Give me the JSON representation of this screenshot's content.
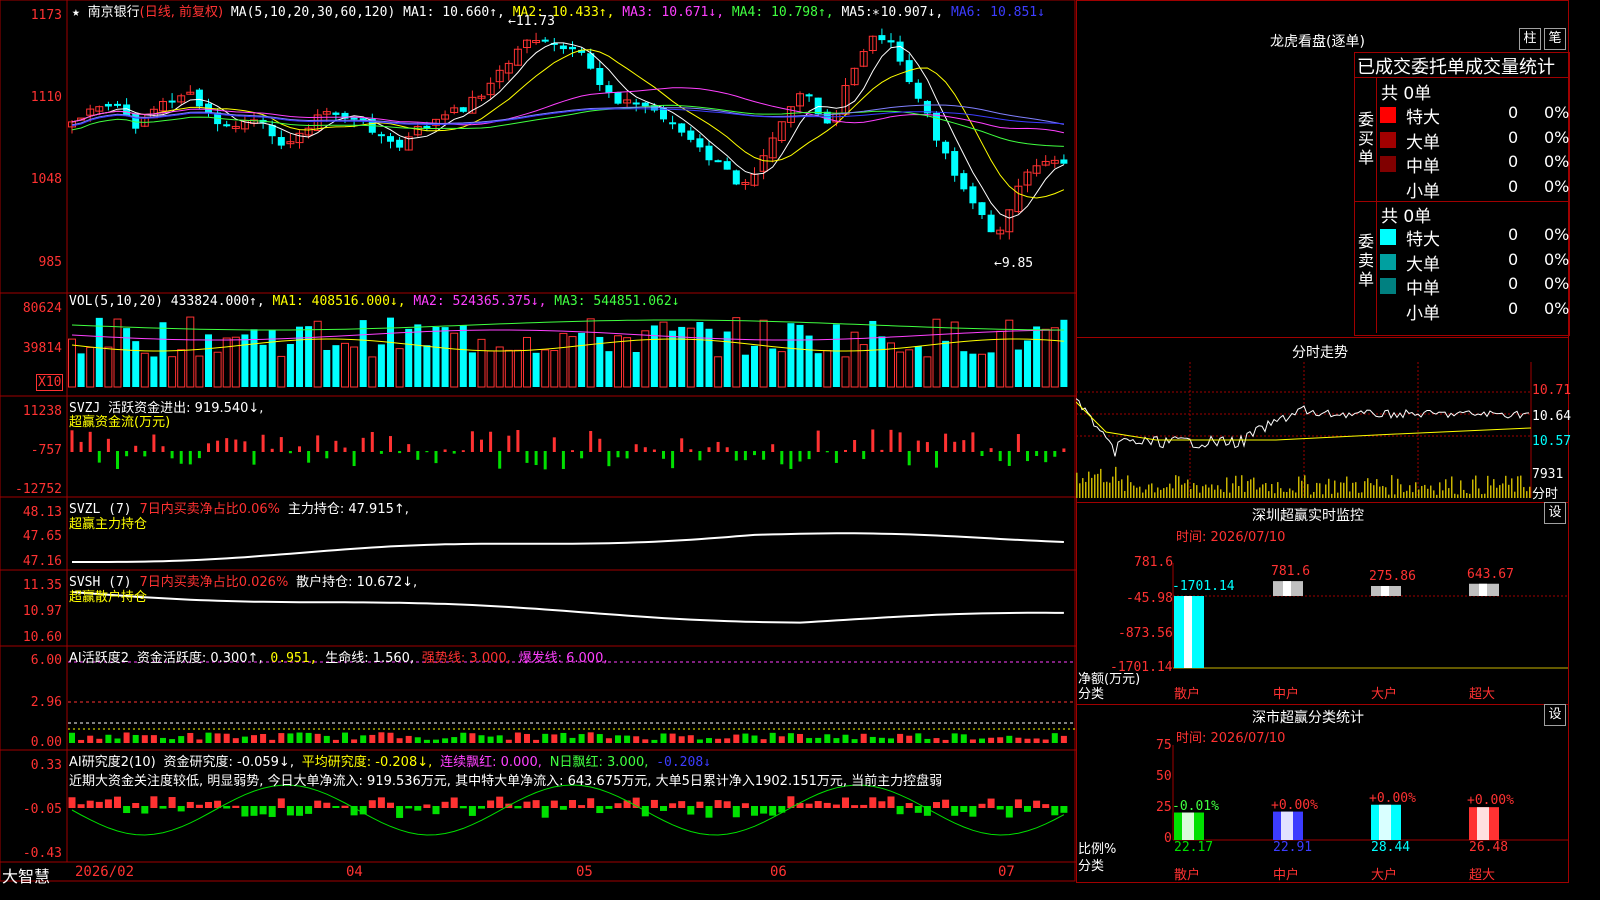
{
  "header": {
    "star": "★",
    "stock_name": "南京银行",
    "period": "(日线, 前复权)",
    "ma_params": "MA(5,10,20,30,60,120)",
    "ma1": "MA1: 10.660↑,",
    "ma2": "MA2: 10.433↑,",
    "ma3": "MA3: 10.671↓,",
    "ma4": "MA4: 10.798↑,",
    "ma5": "MA5: 10.907↓,",
    "ma6": "MA6: 10.851↓"
  },
  "price_axis": [
    "1173",
    "1110",
    "1048",
    "985"
  ],
  "price_marks": {
    "high": "←11.73",
    "low": "←9.85",
    "high_star": "*"
  },
  "vol": {
    "label": "VOL(5,10,20)",
    "value": "433824.000↑,",
    "ma1": "MA1: 408516.000↓,",
    "ma2": "MA2: 524365.375↓,",
    "ma3": "MA3: 544851.062↓",
    "axis": [
      "80624",
      "39814"
    ],
    "unit": "X10"
  },
  "svzj": {
    "label": "SVZJ",
    "text": "活跃资金进出: 919.540↓,",
    "sub": "超赢资金流(万元)",
    "axis": [
      "11238",
      "-757",
      "-12752"
    ]
  },
  "svzl": {
    "label": "SVZL (7)",
    "text1": "7日内买卖净占比0.06%",
    "text2": "主力持仓: 47.915↑,",
    "sub": "超赢主力持仓",
    "axis": [
      "48.13",
      "47.65",
      "47.16"
    ]
  },
  "svsh": {
    "label": "SVSH (7)",
    "text1": "7日内买卖净占比0.026%",
    "text2": "散户持仓: 10.672↓,",
    "sub": "超赢散户持仓",
    "axis": [
      "11.35",
      "10.97",
      "10.60"
    ]
  },
  "ai1": {
    "label": "AI活跃度2",
    "t1": "资金活跃度: 0.300↑,",
    "t2": "0.951,",
    "t3": "生命线: 1.560,",
    "t4": "强势线: 3.000,",
    "t5": "爆发线: 6.000,",
    "axis": [
      "6.00",
      "2.96",
      "0.00"
    ]
  },
  "ai2": {
    "label": "AI研究度2(10)",
    "t1": "资金研究度: -0.059↓,",
    "t2": "平均研究度: -0.208↓,",
    "t3": "连续飘红: 0.000,",
    "t4": "N日飘红: 3.000,",
    "t5": "-0.208↓",
    "comment": "近期大资金关注度较低, 明显弱势, 今日大单净流入: 919.536万元, 其中特大单净流入: 643.675万元, 大单5日累计净入1902.151万元, 当前主力控盘弱",
    "axis": [
      "0.33",
      "-0.05",
      "-0.43"
    ]
  },
  "bottom": {
    "brand": "大智慧",
    "dates": [
      "2026/02",
      "04",
      "05",
      "06",
      "07"
    ]
  },
  "dragon": {
    "title": "龙虎看盘(逐单)",
    "btn1": "柱",
    "btn2": "笔",
    "subtitle": "已成交委托单成交量统计",
    "buy_label": "委买单",
    "sell_label": "委卖单",
    "buy_total": "共 0单",
    "sell_total": "共 0单",
    "rows": [
      {
        "name": "特大",
        "count": "0",
        "pct": "0%"
      },
      {
        "name": "大单",
        "count": "0",
        "pct": "0%"
      },
      {
        "name": "中单",
        "count": "0",
        "pct": "0%"
      },
      {
        "name": "小单",
        "count": "0",
        "pct": "0%"
      }
    ],
    "buy_colors": [
      "#ff0000",
      "#a00000",
      "#800000",
      "#000000"
    ],
    "sell_colors": [
      "#00ffff",
      "#00a0a0",
      "#008080",
      "#000000"
    ]
  },
  "intraday": {
    "title": "分时走势",
    "axis": [
      "10.71",
      "10.64",
      "10.57"
    ],
    "vol_label": "7931",
    "unit_label": "分时"
  },
  "sz_monitor": {
    "title": "深圳超赢实时监控",
    "btn": "设",
    "time": "时间: 2026/07/10",
    "axis": [
      "781.6",
      "-45.98",
      "-873.56",
      "-1701.14"
    ],
    "ylabel": "净额(万元)",
    "xlabel": "分类",
    "cats": [
      "散户",
      "中户",
      "大户",
      "超大"
    ],
    "values": [
      -1701.14,
      781.6,
      275.86,
      643.67
    ],
    "value_labels": [
      "-1701.14",
      "781.6",
      "275.86",
      "643.67"
    ]
  },
  "sz_class": {
    "title": "深市超赢分类统计",
    "btn": "设",
    "time": "时间: 2026/07/10",
    "axis": [
      "75",
      "50",
      "25",
      "0"
    ],
    "ylabel": "比例%",
    "xlabel": "分类",
    "cats": [
      "散户",
      "中户",
      "大户",
      "超大"
    ],
    "values": [
      22.17,
      22.91,
      28.44,
      26.48
    ],
    "change_labels": [
      "-0.01%",
      "+0.00%",
      "+0.00%",
      "+0.00%"
    ]
  }
}
